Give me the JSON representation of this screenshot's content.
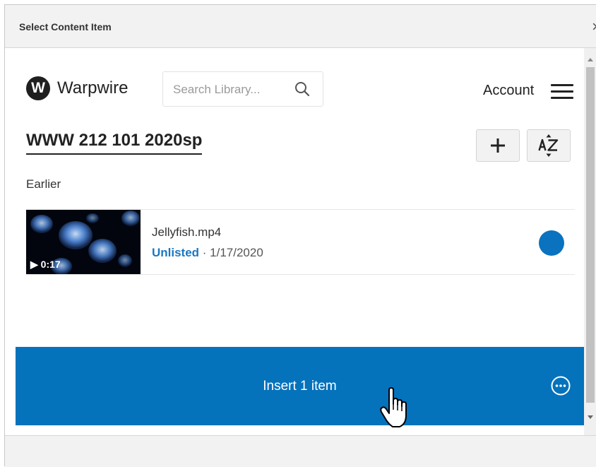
{
  "dialog": {
    "title": "Select Content Item",
    "close_glyph": "×"
  },
  "brand": {
    "mark": "W",
    "name": "Warpwire"
  },
  "search": {
    "placeholder": "Search Library..."
  },
  "header": {
    "account_label": "Account"
  },
  "library": {
    "title": "WWW 212 101 2020sp",
    "add_glyph": "+"
  },
  "section": {
    "label": "Earlier"
  },
  "items": [
    {
      "name": "Jellyfish.mp4",
      "status": "Unlisted",
      "separator": " · ",
      "date": "1/17/2020",
      "duration": "▶ 0:17",
      "selected": true
    }
  ],
  "insert": {
    "label": "Insert 1 item"
  },
  "icons": {
    "close": "close-icon",
    "search": "search-icon",
    "menu": "menu-icon",
    "add": "plus-icon",
    "sort": "sort-az-icon",
    "more": "more-options-icon",
    "cursor": "hand-pointer-icon"
  },
  "colors": {
    "accent": "#0572bc",
    "status_link": "#1a78c2",
    "selected_dot": "#0a72bf"
  }
}
